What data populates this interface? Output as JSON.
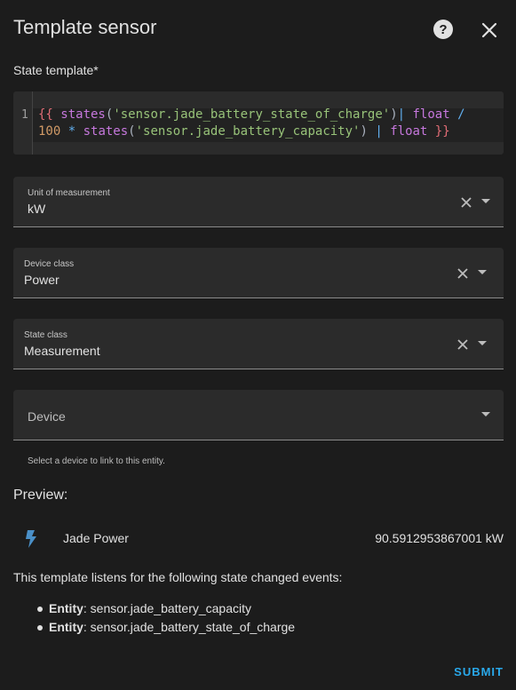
{
  "dialog": {
    "title": "Template sensor"
  },
  "state_template": {
    "label": "State template*",
    "line_number": "1",
    "tokens": [
      {
        "text": "{{",
        "kind": "brace"
      },
      {
        "text": " states",
        "kind": "fn"
      },
      {
        "text": "(",
        "kind": "paren"
      },
      {
        "text": "'sensor.jade_battery_state_of_charge'",
        "kind": "str"
      },
      {
        "text": ")",
        "kind": "paren"
      },
      {
        "text": "|",
        "kind": "op"
      },
      {
        "text": " float ",
        "kind": "fn"
      },
      {
        "text": "/",
        "kind": "op"
      },
      {
        "text": "\n100 ",
        "kind": "num"
      },
      {
        "text": "*",
        "kind": "op"
      },
      {
        "text": " states",
        "kind": "fn"
      },
      {
        "text": "(",
        "kind": "paren"
      },
      {
        "text": "'sensor.jade_battery_capacity'",
        "kind": "str"
      },
      {
        "text": ")",
        "kind": "paren"
      },
      {
        "text": " | ",
        "kind": "op"
      },
      {
        "text": "float",
        "kind": "fn"
      },
      {
        "text": " }}",
        "kind": "brace"
      }
    ]
  },
  "unit_field": {
    "label": "Unit of measurement",
    "value": "kW"
  },
  "device_class_field": {
    "label": "Device class",
    "value": "Power"
  },
  "state_class_field": {
    "label": "State class",
    "value": "Measurement"
  },
  "device_field": {
    "placeholder": "Device",
    "helper": "Select a device to link to this entity."
  },
  "preview": {
    "label": "Preview:",
    "icon": "flash-icon",
    "entity_name": "Jade Power",
    "entity_state": "90.5912953867001 kW"
  },
  "listens": {
    "text": "This template listens for the following state changed events:",
    "items": [
      {
        "kind": "Entity",
        "value": ": sensor.jade_battery_capacity"
      },
      {
        "kind": "Entity",
        "value": ": sensor.jade_battery_state_of_charge"
      }
    ]
  },
  "actions": {
    "submit": "SUBMIT"
  },
  "colors": {
    "accent": "#29a8ea",
    "background": "#1c1c1c",
    "field": "#2b2b2b"
  }
}
